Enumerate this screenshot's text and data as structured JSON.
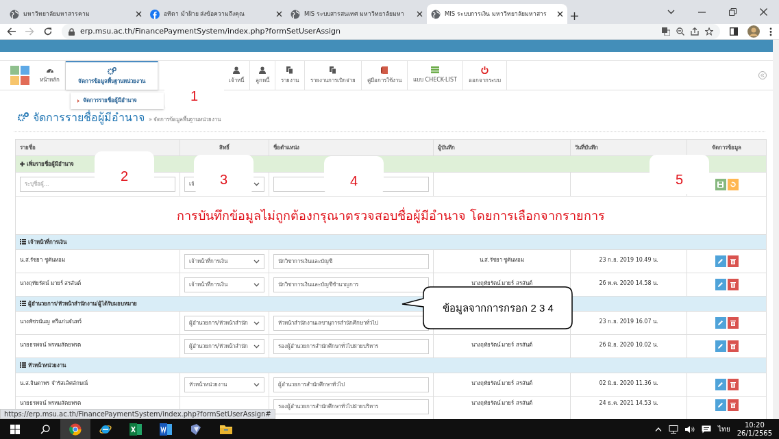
{
  "browser": {
    "tabs": [
      {
        "title": "มหาวิทยาลัยมหาสารคาม",
        "kind": "globe",
        "selected": false
      },
      {
        "title": "อทิตา ม้าฝ้าย ส่งข้อความถึงคุณ",
        "kind": "facebook",
        "selected": false
      },
      {
        "title": "MIS ระบบสารสนเทศ มหาวิทยาลัยมหา",
        "kind": "globe",
        "selected": false
      },
      {
        "title": "MIS ระบบการเงิน มหาวิทยาลัยมหาสาร",
        "kind": "globe",
        "selected": true
      }
    ],
    "url": "erp.msu.ac.th/FinancePaymentSystem/index.php?formSetUserAssign",
    "status_url": "https://erp.msu.ac.th/FinancePaymentSystem/index.php?formSetUserAssign#"
  },
  "toolbar": {
    "items": [
      {
        "label": "หน้าหลัก",
        "kind": "dashboard",
        "selected": false
      },
      {
        "label": "จัดการข้อมูลพื้นฐานหน่วยงาน",
        "kind": "gears",
        "selected": true
      },
      {
        "label": "เจ้าหนี้",
        "kind": "user",
        "selected": false
      },
      {
        "label": "ลูกหนี้",
        "kind": "user",
        "selected": false
      },
      {
        "label": "รายงาน",
        "kind": "copy",
        "selected": false
      },
      {
        "label": "รายงานการเบิกจ่าย",
        "kind": "copy",
        "selected": false
      },
      {
        "label": "คู่มือการใช้งาน",
        "kind": "book",
        "selected": false
      },
      {
        "label": "แบบ CHECK-LIST",
        "kind": "list",
        "selected": false
      },
      {
        "label": "ออกจากระบบ",
        "kind": "power",
        "selected": false
      }
    ],
    "submenu": [
      {
        "label": "จัดการรายชื่อผู้มีอำนาจ"
      }
    ]
  },
  "page": {
    "title": "จัดการรายชื่อผู้มีอำนาจ",
    "breadcrumb": "» จัดการข้อมูลพื้นฐานหน่วยงาน"
  },
  "table": {
    "columns": [
      "รายชื่อ",
      "สิทธิ์",
      "ชื่อตำแหน่ง",
      "ผู้บันทึก",
      "วันที่บันทึก",
      "จัดการข้อมูล"
    ],
    "add_row": {
      "label": "เพิ่มรายชื่อผู้มีอำนาจ",
      "name_placeholder": "ระบุชื่อผู้...",
      "role_value": "เจ้"
    },
    "error": "การบันทึกข้อมูลไม่ถูกต้องกรุณาตรวจสอบชื่อผู้มีอำนาจ โดยการเลือกจากรายการ",
    "groups": [
      {
        "title": "เจ้าหน้าที่การเงิน",
        "rows": [
          {
            "name": "น.ส.รัชยา ชูคันหอม",
            "role": "เจ้าหน้าที่การเงิน",
            "position": "นักวิชาการเงินและบัญชี",
            "recorder": "น.ส.รัชยา ชูคันหอม",
            "date": "23 ก.ย. 2019 10.49 น."
          },
          {
            "name": "นางฤทัยรัตน์ มายร์ สรสันต์",
            "role": "เจ้าหน้าที่การเงิน",
            "position": "นักวิชาการเงินและบัญชีชำนาญการ",
            "recorder": "นางฤทัยรัตน์ มายร์ สรสันต์",
            "date": "26 พ.ค. 2020 14.58 น."
          }
        ]
      },
      {
        "title": "ผู้อำนวยการ/หัวหน้าสำนักงาน/ผู้ได้รับมอบหมาย",
        "rows": [
          {
            "name": "นางพัชรนันญ ศรีแก่นจันทร์",
            "role": "ผู้อำนวยการ/หัวหน้าสำนัก",
            "position": "หัวหน้าสำนักงานเลขานุการสำนักศึกษาทั่วไป",
            "date": "23 ก.ย. 2019 16.07 น."
          },
          {
            "name": "นายธรพจน์ พรหมสัตยพรต",
            "role": "ผู้อำนวยการ/หัวหน้าสำนัก",
            "position": "รองผู้อำนวยการสำนักศึกษาทั่วไปฝ่ายบริหาร",
            "recorder": "นางฤทัยรัตน์ มายร์ สรสันต์",
            "date": "26 มิ.ย. 2020 10.02 น."
          }
        ]
      },
      {
        "title": "หัวหน้าหน่วยงาน",
        "rows": [
          {
            "name": "น.ส.จินดาพร จำรัสเลิศลักษณ์",
            "role": "หัวหน้าหน่วยงาน",
            "position": "ผู้อำนวยการสำนักศึกษาทั่วไป",
            "recorder": "นางฤทัยรัตน์ มายร์ สรสันต์",
            "date": "02 มิ.ย. 2020 11.36 น."
          },
          {
            "name": "นายธรพจน์ พรหมสัตยพรต",
            "position": "รองผู้อำนวยการสำนักศึกษาทั่วไปฝ่ายบริหาร",
            "recorder": "นางฤทัยรัตน์ มายร์ สรสันต์",
            "date": "24 ธ.ค. 2021 14.53 น."
          }
        ]
      }
    ]
  },
  "annotations": {
    "markers": [
      "1",
      "2",
      "3",
      "4",
      "5"
    ],
    "callout": "ข้อมูลจากการกรอก 2 3 4"
  },
  "taskbar": {
    "language": "ไทย",
    "time": "10:20",
    "date": "26/1/2565"
  }
}
